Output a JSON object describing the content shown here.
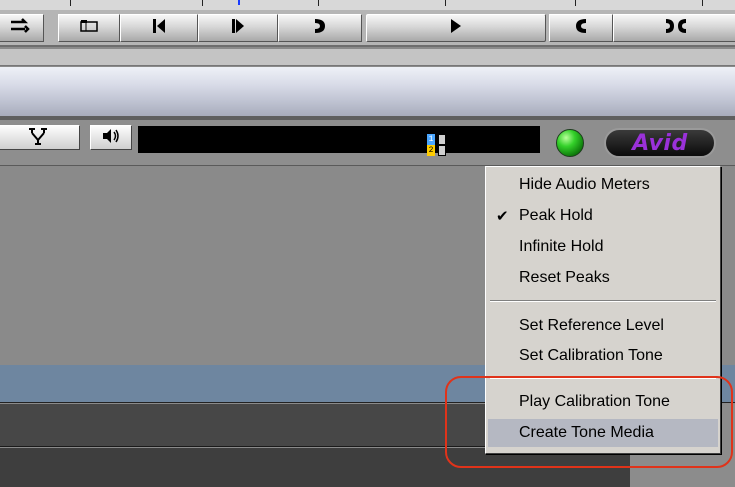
{
  "toolbar": {
    "icons": [
      "track-swap-icon",
      "clip-icon",
      "step-back-icon",
      "step-forward-icon",
      "mark-out-icon",
      "play-icon",
      "mark-in-icon",
      "mark-in-out-icon"
    ]
  },
  "control_bar": {
    "icons": [
      "trim-tool-icon",
      "speaker-icon",
      "meter-channels-icon",
      "meter-list-icon",
      "status-led-icon"
    ],
    "meter_channels": [
      "1",
      "2"
    ],
    "logo_text": "Avid"
  },
  "audio_meter_menu": {
    "items": [
      {
        "label": "Hide Audio Meters",
        "checked": false
      },
      {
        "label": "Peak Hold",
        "checked": true
      },
      {
        "label": "Infinite Hold",
        "checked": false
      },
      {
        "label": "Reset Peaks",
        "checked": false
      },
      {
        "label": "Set Reference Level",
        "checked": false
      },
      {
        "label": "Set Calibration Tone",
        "checked": false
      },
      {
        "label": "Play Calibration Tone",
        "checked": false
      },
      {
        "label": "Create Tone Media",
        "checked": false,
        "highlighted": true
      }
    ],
    "check_glyph": "✔"
  },
  "colors": {
    "menu_bg": "#d6d3ce",
    "menu_highlight": "#b5b8c2",
    "annotation_red": "#e0331a",
    "logo_purple": "#9a31d9",
    "led_green": "#34d12a",
    "timeline_blue": "#6e86a0"
  }
}
